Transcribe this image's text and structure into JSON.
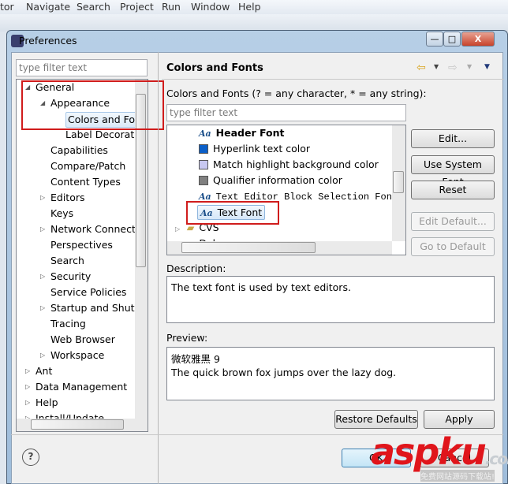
{
  "menubar": {
    "items": [
      "tor",
      "Navigate",
      "Search",
      "Project",
      "Run",
      "Window",
      "Help"
    ]
  },
  "dialog": {
    "title": "Preferences",
    "minimize": "—",
    "maximize": "□",
    "close": "X"
  },
  "left": {
    "filter_placeholder": "type filter text",
    "tree": [
      {
        "label": "General",
        "level": 0,
        "arrow": "expanded"
      },
      {
        "label": "Appearance",
        "level": 1,
        "arrow": "expanded"
      },
      {
        "label": "Colors and Fonts",
        "level": 2,
        "arrow": "none",
        "selected": true
      },
      {
        "label": "Label Decorations",
        "level": 2,
        "arrow": "none"
      },
      {
        "label": "Capabilities",
        "level": 1,
        "arrow": "none"
      },
      {
        "label": "Compare/Patch",
        "level": 1,
        "arrow": "none"
      },
      {
        "label": "Content Types",
        "level": 1,
        "arrow": "none"
      },
      {
        "label": "Editors",
        "level": 1,
        "arrow": "collapsed"
      },
      {
        "label": "Keys",
        "level": 1,
        "arrow": "none"
      },
      {
        "label": "Network Connections",
        "level": 1,
        "arrow": "collapsed"
      },
      {
        "label": "Perspectives",
        "level": 1,
        "arrow": "none"
      },
      {
        "label": "Search",
        "level": 1,
        "arrow": "none"
      },
      {
        "label": "Security",
        "level": 1,
        "arrow": "collapsed"
      },
      {
        "label": "Service Policies",
        "level": 1,
        "arrow": "none"
      },
      {
        "label": "Startup and Shutdown",
        "level": 1,
        "arrow": "collapsed"
      },
      {
        "label": "Tracing",
        "level": 1,
        "arrow": "none"
      },
      {
        "label": "Web Browser",
        "level": 1,
        "arrow": "none"
      },
      {
        "label": "Workspace",
        "level": 1,
        "arrow": "collapsed"
      },
      {
        "label": "Ant",
        "level": 0,
        "arrow": "collapsed"
      },
      {
        "label": "Data Management",
        "level": 0,
        "arrow": "collapsed"
      },
      {
        "label": "Help",
        "level": 0,
        "arrow": "collapsed"
      },
      {
        "label": "Install/Update",
        "level": 0,
        "arrow": "collapsed"
      }
    ]
  },
  "right": {
    "title": "Colors and Fonts",
    "instruction": "Colors and Fonts (? = any character, * = any string):",
    "filter_placeholder": "type filter text",
    "list": [
      {
        "label": "Header Font",
        "kind": "font",
        "bold": true
      },
      {
        "label": "Hyperlink text color",
        "kind": "color",
        "color": "#0b5fc8"
      },
      {
        "label": "Match highlight background color",
        "kind": "color",
        "color": "#c8c8f0"
      },
      {
        "label": "Qualifier information color",
        "kind": "color",
        "color": "#808080"
      },
      {
        "label": "Text Editor Block Selection Font",
        "kind": "font",
        "mono": true
      },
      {
        "label": "Text Font",
        "kind": "font",
        "selected": true
      },
      {
        "label": "CVS",
        "kind": "category"
      },
      {
        "label": "Debug",
        "kind": "category"
      }
    ],
    "font_icon": "Aa",
    "buttons": {
      "edit": "Edit...",
      "use_system": "Use System Font",
      "reset": "Reset",
      "edit_default": "Edit Default...",
      "go_to_default": "Go to Default"
    },
    "description_label": "Description:",
    "description": "The text font is used by text editors.",
    "preview_label": "Preview:",
    "preview_line1": "微软雅黑 9",
    "preview_line2": "The quick brown fox jumps over the lazy dog.",
    "restore_defaults": "Restore Defaults",
    "apply": "Apply"
  },
  "footer": {
    "help": "?",
    "ok": "OK",
    "cancel": "Cancel"
  },
  "watermark": {
    "text": "aspku",
    "suffix": ".com",
    "subtitle": "免费网站源码下载站!"
  },
  "colors": {
    "highlight_box": "#d01c1c",
    "watermark": "#e0151b"
  }
}
